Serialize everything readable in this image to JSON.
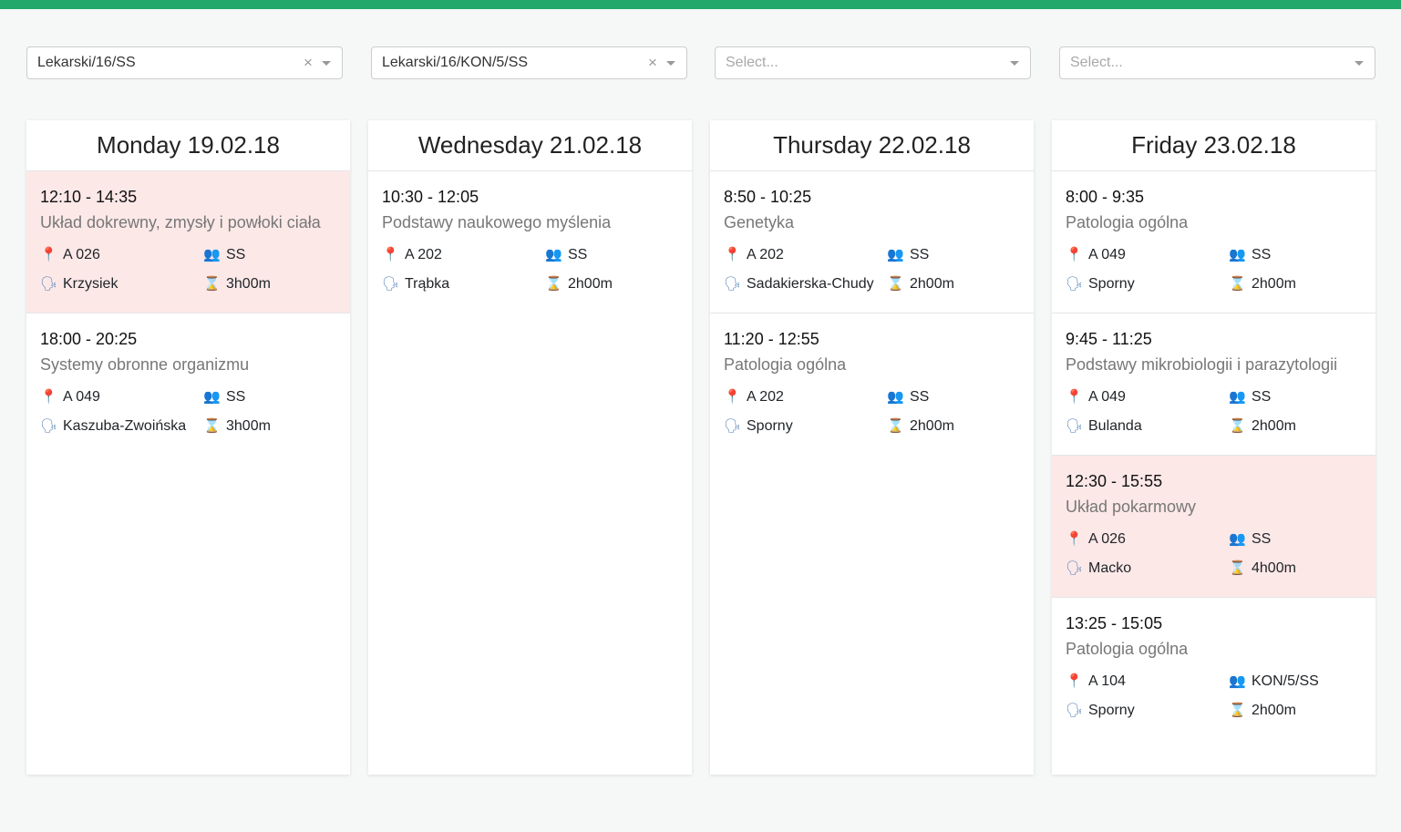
{
  "filters": [
    {
      "value": "Lekarski/16/SS",
      "placeholder": "",
      "clearable": true
    },
    {
      "value": "Lekarski/16/KON/5/SS",
      "placeholder": "",
      "clearable": true
    },
    {
      "value": "",
      "placeholder": "Select...",
      "clearable": false
    },
    {
      "value": "",
      "placeholder": "Select...",
      "clearable": false
    }
  ],
  "icons": {
    "room": "pin-icon",
    "group": "group-icon",
    "teacher": "speaking-head-icon",
    "duration": "hourglass-icon"
  },
  "colors": {
    "accent": "#22a86a",
    "highlight": "#fde8e8"
  },
  "days": [
    {
      "title": "Monday 19.02.18",
      "lessons": [
        {
          "time": "12:10 - 14:35",
          "subject": "Układ dokrewny, zmysły i powłoki ciała",
          "room": "A 026",
          "group": "SS",
          "teacher": "Krzysiek",
          "duration": "3h00m",
          "highlight": true
        },
        {
          "time": "18:00 - 20:25",
          "subject": "Systemy obronne organizmu",
          "room": "A 049",
          "group": "SS",
          "teacher": "Kaszuba-Zwoińska",
          "duration": "3h00m",
          "highlight": false
        }
      ]
    },
    {
      "title": "Wednesday 21.02.18",
      "lessons": [
        {
          "time": "10:30 - 12:05",
          "subject": "Podstawy naukowego myślenia",
          "room": "A 202",
          "group": "SS",
          "teacher": "Trąbka",
          "duration": "2h00m",
          "highlight": false
        }
      ]
    },
    {
      "title": "Thursday 22.02.18",
      "lessons": [
        {
          "time": "8:50 - 10:25",
          "subject": "Genetyka",
          "room": "A 202",
          "group": "SS",
          "teacher": "Sadakierska-Chudy",
          "duration": "2h00m",
          "highlight": false
        },
        {
          "time": "11:20 - 12:55",
          "subject": "Patologia ogólna",
          "room": "A 202",
          "group": "SS",
          "teacher": "Sporny",
          "duration": "2h00m",
          "highlight": false
        }
      ]
    },
    {
      "title": "Friday 23.02.18",
      "lessons": [
        {
          "time": "8:00 - 9:35",
          "subject": "Patologia ogólna",
          "room": "A 049",
          "group": "SS",
          "teacher": "Sporny",
          "duration": "2h00m",
          "highlight": false
        },
        {
          "time": "9:45 - 11:25",
          "subject": "Podstawy mikrobiologii i parazytologii",
          "room": "A 049",
          "group": "SS",
          "teacher": "Bulanda",
          "duration": "2h00m",
          "highlight": false
        },
        {
          "time": "12:30 - 15:55",
          "subject": "Układ pokarmowy",
          "room": "A 026",
          "group": "SS",
          "teacher": "Macko",
          "duration": "4h00m",
          "highlight": true
        },
        {
          "time": "13:25 - 15:05",
          "subject": "Patologia ogólna",
          "room": "A 104",
          "group": "KON/5/SS",
          "teacher": "Sporny",
          "duration": "2h00m",
          "highlight": false
        }
      ]
    }
  ]
}
